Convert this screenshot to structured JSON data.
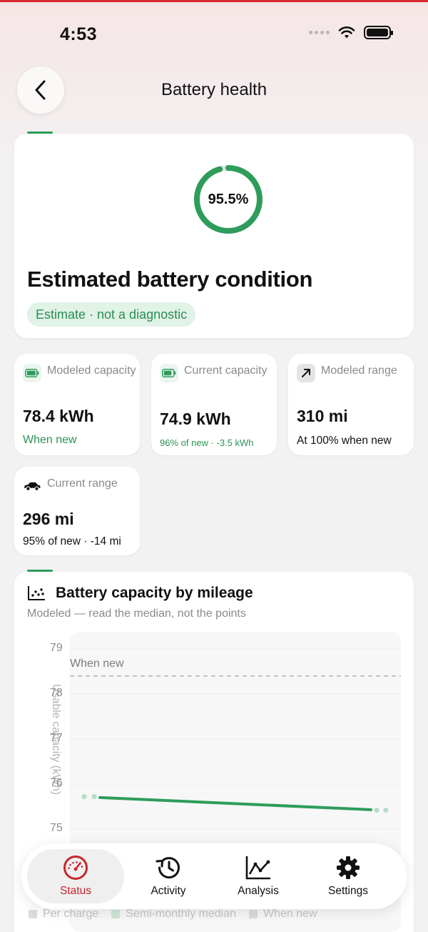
{
  "status_bar": {
    "time": "4:53"
  },
  "header": {
    "title": "Battery health"
  },
  "hero": {
    "percent_label": "95.5%",
    "percent_value": 95.5,
    "title": "Estimated battery condition",
    "pill": "Estimate · not a diagnostic"
  },
  "metrics": [
    {
      "label": "Modeled capacity",
      "value": "78.4 kWh",
      "sub": "When new",
      "icon": "battery-full-icon"
    },
    {
      "label": "Current capacity",
      "value": "74.9 kWh",
      "sub": "96% of new · -3.5 kWh",
      "icon": "battery-icon"
    },
    {
      "label": "Modeled range",
      "value": "310 mi",
      "sub": "At 100% when new",
      "icon": "arrow-up-right-icon"
    },
    {
      "label": "Current range",
      "value": "296 mi",
      "sub": "95% of new · -14 mi",
      "icon": "car-icon"
    }
  ],
  "chart": {
    "title": "Battery capacity by mileage",
    "subtitle": "Modeled — read the median, not the points",
    "ylabel": "Usable capacity (kWh)",
    "when_new_label": "When new",
    "legend": [
      "Per charge",
      "Semi-monthly median",
      "When new"
    ]
  },
  "chart_data": {
    "type": "line",
    "ylabel": "Usable capacity (kWh)",
    "y_ticks": [
      79,
      78,
      77,
      76,
      75
    ],
    "ylim": [
      74.6,
      79.2
    ],
    "reference_line": {
      "name": "When new",
      "y": 78.4,
      "style": "dashed"
    },
    "series": [
      {
        "name": "Semi-monthly median",
        "type": "line",
        "color": "#2e9c5b",
        "start_y": 75.7,
        "end_y": 75.43
      },
      {
        "name": "Per charge",
        "type": "scatter",
        "color": "#b9dcc7",
        "points_y": [
          75.72,
          75.72,
          75.42,
          75.42
        ]
      }
    ],
    "grid": true
  },
  "tabs": [
    {
      "label": "Status",
      "icon": "speedometer-icon",
      "active": true
    },
    {
      "label": "Activity",
      "icon": "history-icon",
      "active": false
    },
    {
      "label": "Analysis",
      "icon": "chart-line-icon",
      "active": false
    },
    {
      "label": "Settings",
      "icon": "gear-icon",
      "active": false
    }
  ],
  "colors": {
    "accent": "#2e9c5b",
    "active_tab": "#c8262b",
    "top_bar": "#d8282d"
  }
}
